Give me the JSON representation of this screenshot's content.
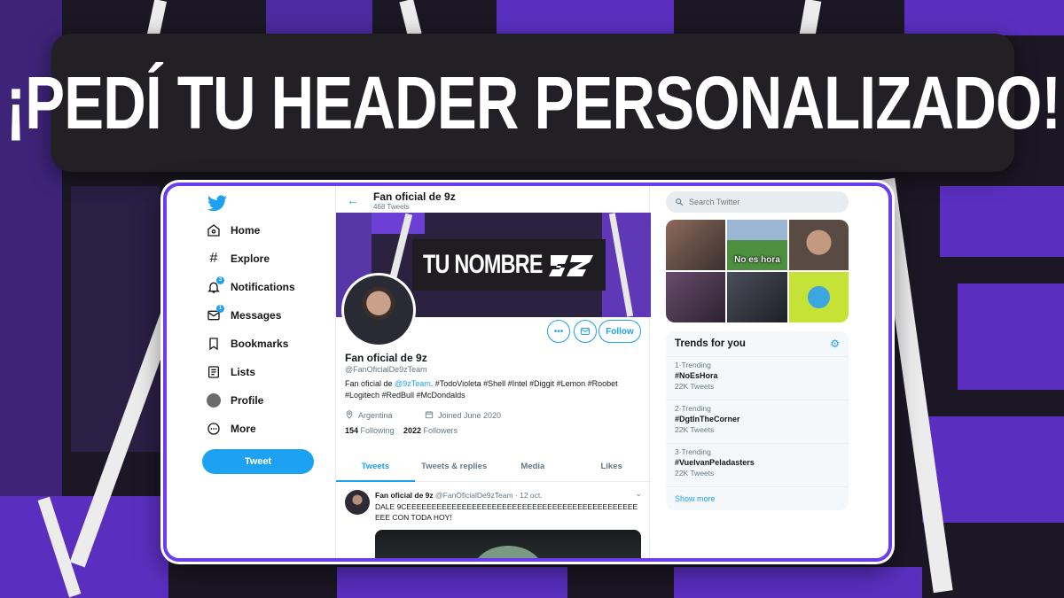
{
  "headline": "¡PEDÍ TU HEADER PERSONALIZADO!",
  "colors": {
    "accent": "#1da1f2",
    "brand_purple": "#6a3df0",
    "background": "#1b1724"
  },
  "sidebar": {
    "logo_icon": "twitter-bird-icon",
    "items": [
      {
        "label": "Home",
        "icon": "home-icon"
      },
      {
        "label": "Explore",
        "icon": "hashtag-icon"
      },
      {
        "label": "Notifications",
        "icon": "bell-icon",
        "badge": "3"
      },
      {
        "label": "Messages",
        "icon": "envelope-icon",
        "badge": "1"
      },
      {
        "label": "Bookmarks",
        "icon": "bookmark-icon"
      },
      {
        "label": "Lists",
        "icon": "list-icon"
      },
      {
        "label": "Profile",
        "icon": "avatar-icon"
      },
      {
        "label": "More",
        "icon": "more-icon"
      }
    ],
    "tweet_button": "Tweet"
  },
  "profile": {
    "header_name": "Fan oficial de 9z",
    "tweet_count": "468 Tweets",
    "banner_text": "TU NOMBRE",
    "name": "Fan oficial de 9z",
    "handle": "@FanOficialDe9zTeam",
    "bio_prefix": "Fan oficial de",
    "bio_mention": "@9zTeam",
    "bio_rest": ". #TodoVioleta #Shell #Intel #Diggit #Lemon #Roobet #Logitech #RedBull #McDondalds",
    "location": "Argentina",
    "joined": "Joined June 2020",
    "following_count": "154",
    "following_label": "Following",
    "followers_count": "2022",
    "followers_label": "Followers",
    "follow_button": "Follow"
  },
  "tabs": [
    "Tweets",
    "Tweets & replies",
    "Media",
    "Likes"
  ],
  "tweet": {
    "author": "Fan oficial de 9z",
    "handle_date": "@FanOficialDe9zTeam · 12 oct.",
    "text": "DALE 9CEEEEEEEEEEEEEEEEEEEEEEEEEEEEEEEEEEEEEEEEEEEEEEEEE CON TODA HOY!"
  },
  "search": {
    "placeholder": "Search Twitter"
  },
  "gallery": {
    "caption": "No es hora"
  },
  "trends": {
    "title": "Trends for you",
    "items": [
      {
        "rank": "1·Trending",
        "tag": "#NoEsHora",
        "count": "22K Tweets"
      },
      {
        "rank": "2·Trending",
        "tag": "#DgtInTheCorner",
        "count": "22K Tweets"
      },
      {
        "rank": "3·Trending",
        "tag": "#VuelvanPeladasters",
        "count": "22K Tweets"
      }
    ],
    "show_more": "Show more"
  }
}
